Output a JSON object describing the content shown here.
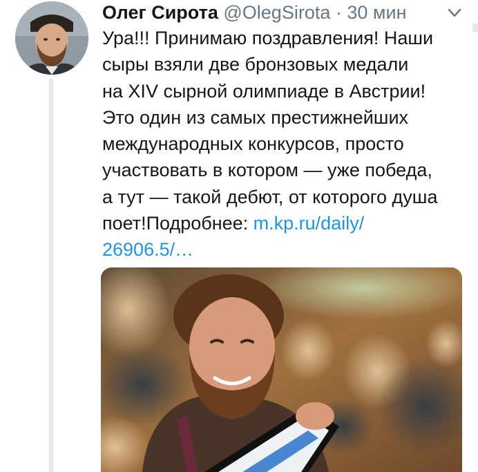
{
  "tweet": {
    "author": {
      "display_name": "Олег Сирота",
      "handle": "@OlegSirota"
    },
    "separator": "·",
    "time": "30 мин",
    "text_lines": [
      "Ура!!! Принимаю поздравления! Наши",
      "сыры взяли две бронзовых медали",
      "на XIV сырной олимпиаде в Австрии!",
      "Это один из самых престижнейших",
      "международных конкурсов, просто",
      "участвовать в котором — уже победа,",
      "а тут — такой дебют, от которого душа"
    ],
    "last_line_text": "поет!Подробнее: ",
    "link_part1": "m.kp.ru/daily/",
    "link_part2": "26906.5/…"
  },
  "icons": {
    "avatar": "profile-photo",
    "menu": "chevron-down-icon",
    "media": "photo"
  },
  "colors": {
    "text": "#14171a",
    "secondary": "#657786",
    "link": "#1b95e0",
    "thread_line": "#e1e8ed"
  }
}
